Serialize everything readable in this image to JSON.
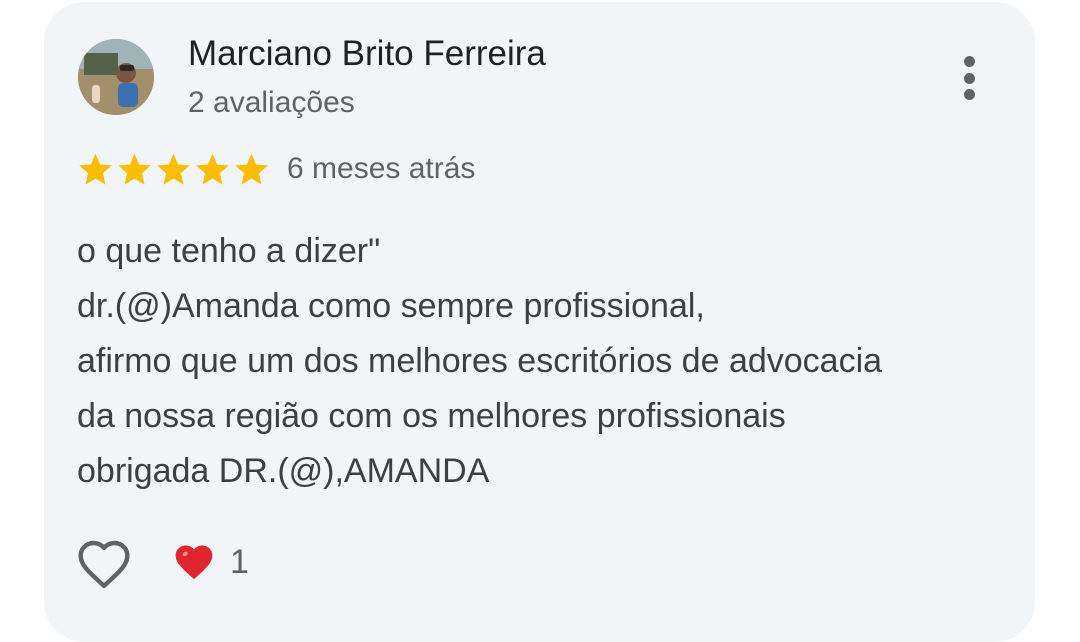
{
  "reviewer": {
    "name": "Marciano Brito Ferreira",
    "review_count": "2 avaliações"
  },
  "review": {
    "rating": 5,
    "rating_max": 5,
    "time_ago": "6 meses atrás",
    "text_lines": [
      "o que tenho a dizer\"",
      "dr.(@)Amanda como sempre profissional,",
      "afirmo que um dos melhores escritórios de advocacia",
      "da nossa região com os melhores profissionais",
      "obrigada DR.(@),AMANDA"
    ]
  },
  "reactions": {
    "like_icon": "heart-outline-icon",
    "reaction_icon": "red-heart-icon",
    "count": "1"
  },
  "menu": {
    "icon": "more-vert-icon"
  },
  "colors": {
    "card_background": "#f2f5f8",
    "star": "#fbbc04",
    "heart_reaction": "#e0252f",
    "primary_text": "#202124",
    "secondary_text": "#5f6368"
  }
}
